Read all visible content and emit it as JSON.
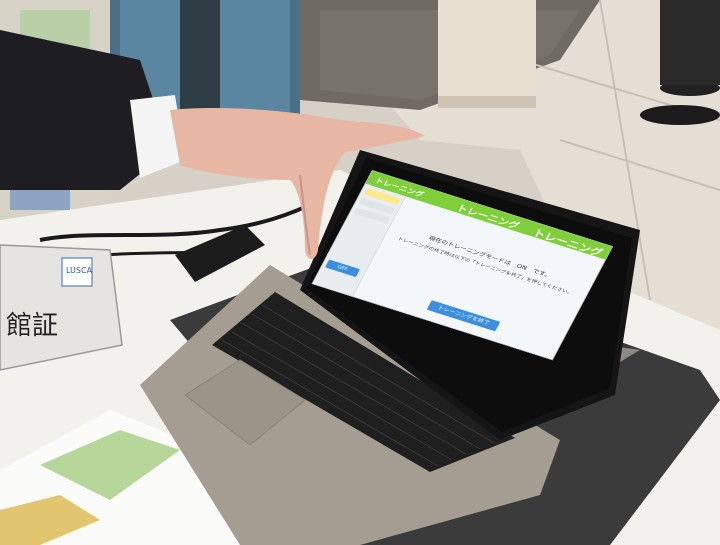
{
  "scene": {
    "description_tags": [
      "tablet",
      "keyboard",
      "hand",
      "reception-desk"
    ]
  },
  "badge": {
    "logo": "LUSCA",
    "title": "館証"
  },
  "tablet": {
    "top_left_title": "トレーニング",
    "top_center_title": "トレーニング",
    "top_right_title": "トレーニング",
    "heading": "現在のトレーニングモードは　ON　です。",
    "message": "トレーニングの終了時は以下の「トレーニングを終了」を押してください。",
    "action_button": "トレーニングを終了",
    "side_button": "OFF"
  }
}
